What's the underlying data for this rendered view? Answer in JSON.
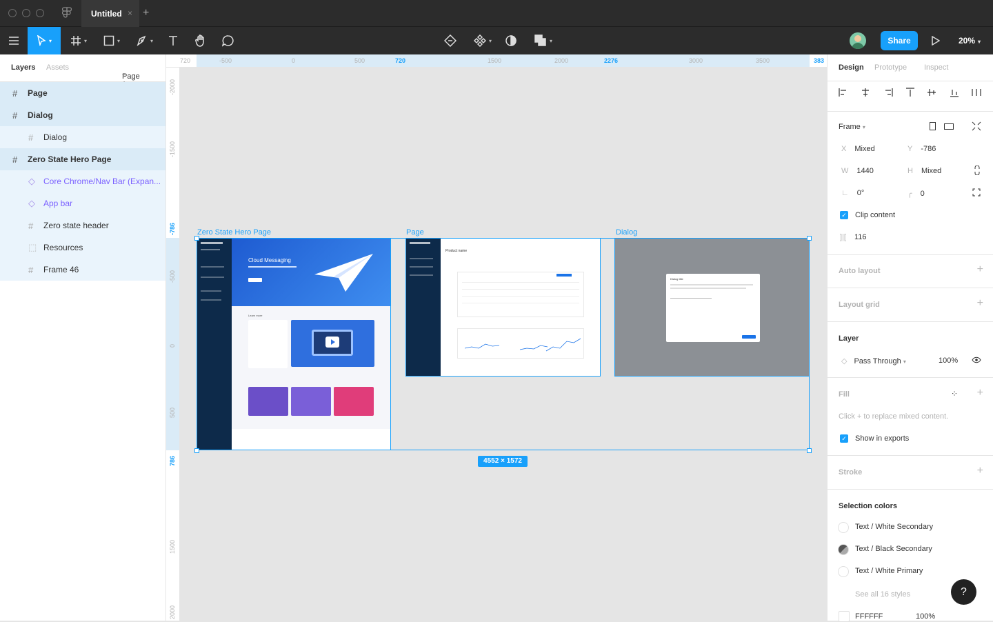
{
  "titlebar": {
    "tab_title": "Untitled",
    "close": "×",
    "new_tab": "+"
  },
  "toolbar": {
    "share_label": "Share",
    "zoom": "20%"
  },
  "left_panel": {
    "tabs": [
      "Layers",
      "Assets"
    ],
    "page_selector": "Page 1",
    "layers": [
      {
        "label": "Page",
        "kind": "frame",
        "bold": true
      },
      {
        "label": "Dialog",
        "kind": "frame",
        "bold": true
      },
      {
        "label": "Dialog",
        "kind": "frame-child",
        "bold": false
      },
      {
        "label": "Zero State Hero Page",
        "kind": "frame",
        "bold": true
      },
      {
        "label": "Core Chrome/Nav Bar (Expan...",
        "kind": "component",
        "bold": false
      },
      {
        "label": "App bar",
        "kind": "component",
        "bold": false
      },
      {
        "label": "Zero state header",
        "kind": "frame-child",
        "bold": false
      },
      {
        "label": "Resources",
        "kind": "group",
        "bold": false
      },
      {
        "label": "Frame 46",
        "kind": "frame-child",
        "bold": false
      }
    ]
  },
  "rulers": {
    "top": [
      "720",
      "-500",
      "0",
      "500",
      "720",
      "1500",
      "2000",
      "2276",
      "3000",
      "3500",
      "383"
    ],
    "left": [
      "-2000",
      "-1500",
      "-786",
      "-500",
      "0",
      "500",
      "786",
      "1500",
      "2000"
    ]
  },
  "canvas": {
    "frame_labels": [
      "Zero State Hero Page",
      "Page",
      "Dialog"
    ],
    "selection_size": "4552 × 1572",
    "hero": {
      "title": "Cloud Messaging",
      "subtitle": "Learn more"
    },
    "page_frame": {
      "title": "Product name"
    },
    "dialog_frame": {
      "title": "Dialog title"
    }
  },
  "right_panel": {
    "tabs": [
      "Design",
      "Prototype",
      "Inspect"
    ],
    "frame_label": "Frame",
    "x_label": "X",
    "x_value": "Mixed",
    "y_label": "Y",
    "y_value": "-786",
    "w_label": "W",
    "w_value": "1440",
    "h_label": "H",
    "h_value": "Mixed",
    "rotation": "0°",
    "radius": "0",
    "clip_content": "Clip content",
    "spacing": "116",
    "auto_layout": "Auto layout",
    "layout_grid": "Layout grid",
    "layer_title": "Layer",
    "blend_mode": "Pass Through",
    "opacity": "100%",
    "fill_title": "Fill",
    "fill_hint": "Click + to replace mixed content.",
    "show_exports": "Show in exports",
    "stroke_title": "Stroke",
    "selection_colors_title": "Selection colors",
    "selection_colors": [
      {
        "name": "Text / White Secondary",
        "color": "#ffffff"
      },
      {
        "name": "Text / Black Secondary",
        "color": "#757575"
      },
      {
        "name": "Text / White Primary",
        "color": "#ffffff"
      }
    ],
    "see_all": "See all 16 styles",
    "hex": "FFFFFF",
    "hex_opacity": "100%"
  },
  "help": "?",
  "colors": {
    "accent": "#18a0fb",
    "toolbar": "#2c2c2c",
    "canvas": "#e5e5e5"
  }
}
